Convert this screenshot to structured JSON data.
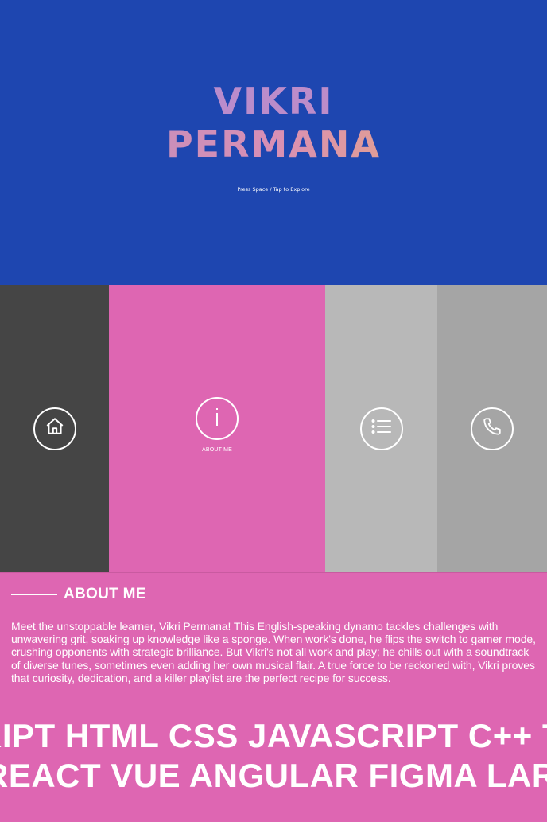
{
  "hero": {
    "title_line1": "VIKRI",
    "title_line2": "PERMANA",
    "hint": "Press Space / Tap to Explore",
    "background": "#1e46b0"
  },
  "nav": {
    "panels": [
      {
        "icon": "home-icon",
        "color": "#454545"
      },
      {
        "icon": "info-icon",
        "label": "ABOUT ME",
        "color": "#de66b2"
      },
      {
        "icon": "list-icon",
        "color": "#b8b8b8"
      },
      {
        "icon": "phone-icon",
        "color": "#a5a5a5"
      }
    ]
  },
  "about": {
    "title": "ABOUT ME",
    "body": "Meet the unstoppable learner, Vikri Permana! This English-speaking dynamo tackles challenges with unwavering grit, soaking up knowledge like a sponge. When work's done, he flips the switch to gamer mode, crushing opponents with strategic brilliance. But Vikri's not all work and play; he chills out with a soundtrack of diverse tunes, sometimes even adding her own musical flair. A true force to be reckoned with, Vikri proves that curiosity, dedication, and a killer playlist are the perfect recipe for success.",
    "marquee_line1": "RIPT HTML CSS JAVASCRIPT C++ T",
    "marquee_line2": "REACT VUE ANGULAR FIGMA LARA"
  }
}
